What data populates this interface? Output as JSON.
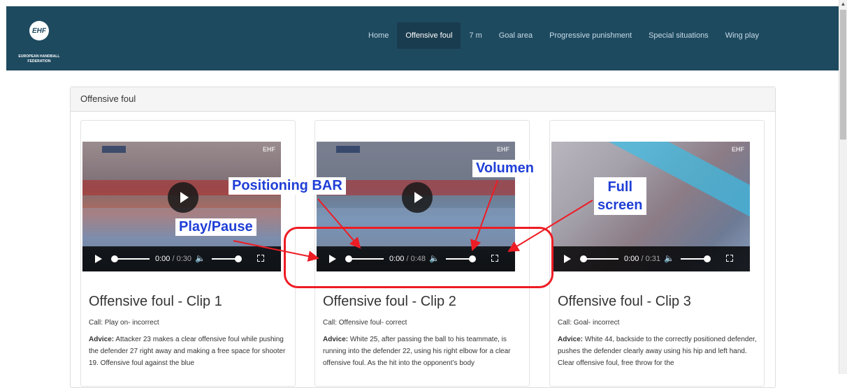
{
  "nav": {
    "logo_mark": "EHF",
    "logo_line1": "EUROPEAN HANDBALL",
    "logo_line2": "FEDERATION",
    "items": [
      {
        "label": "Home"
      },
      {
        "label": "Offensive foul",
        "active": true
      },
      {
        "label": "7 m"
      },
      {
        "label": "Goal area"
      },
      {
        "label": "Progressive punishment"
      },
      {
        "label": "Special situations"
      },
      {
        "label": "Wing play"
      }
    ]
  },
  "panel": {
    "heading": "Offensive foul"
  },
  "clips": [
    {
      "title": "Offensive foul - Clip 1",
      "call": "Call: Play on- incorrect",
      "advice_label": "Advice:",
      "advice": "Attacker 23 makes a clear offensive foul while pushing the defender 27 right away and making a free space for shooter 19. Offensive foul against the blue",
      "time_current": "0:00",
      "time_duration": "/ 0:30",
      "watermark": "EHF"
    },
    {
      "title": "Offensive foul - Clip 2",
      "call": "Call: Offensive foul- correct",
      "advice_label": "Advice:",
      "advice": "White 25, after passing the ball to his teammate, is running into the defender 22, using his right elbow for a clear offensive foul. As the hit into the opponent’s body",
      "time_current": "0:00",
      "time_duration": "/ 0:48",
      "watermark": "EHF"
    },
    {
      "title": "Offensive foul - Clip 3",
      "call": "Call: Goal- incorrect",
      "advice_label": "Advice:",
      "advice": "White 44, backside to the correctly positioned defender, pushes the defender clearly away using his hip and left hand. Clear offensive foul, free throw for the",
      "time_current": "0:00",
      "time_duration": "/ 0:31",
      "watermark": "EHF"
    }
  ],
  "annotations": {
    "positioning": "Positioning BAR",
    "play_pause": "Play/Pause",
    "volumen": "Volumen",
    "full_line1": "Full",
    "full_line2": "screen",
    "color_text": "#1f3fd6",
    "color_highlight": "#ee1c24"
  },
  "colors": {
    "navbar": "#1e4a60",
    "nav_active": "#1a3c4f"
  },
  "icons": [
    "play-icon",
    "volume-icon",
    "fullscreen-icon",
    "scroll-up-icon"
  ]
}
